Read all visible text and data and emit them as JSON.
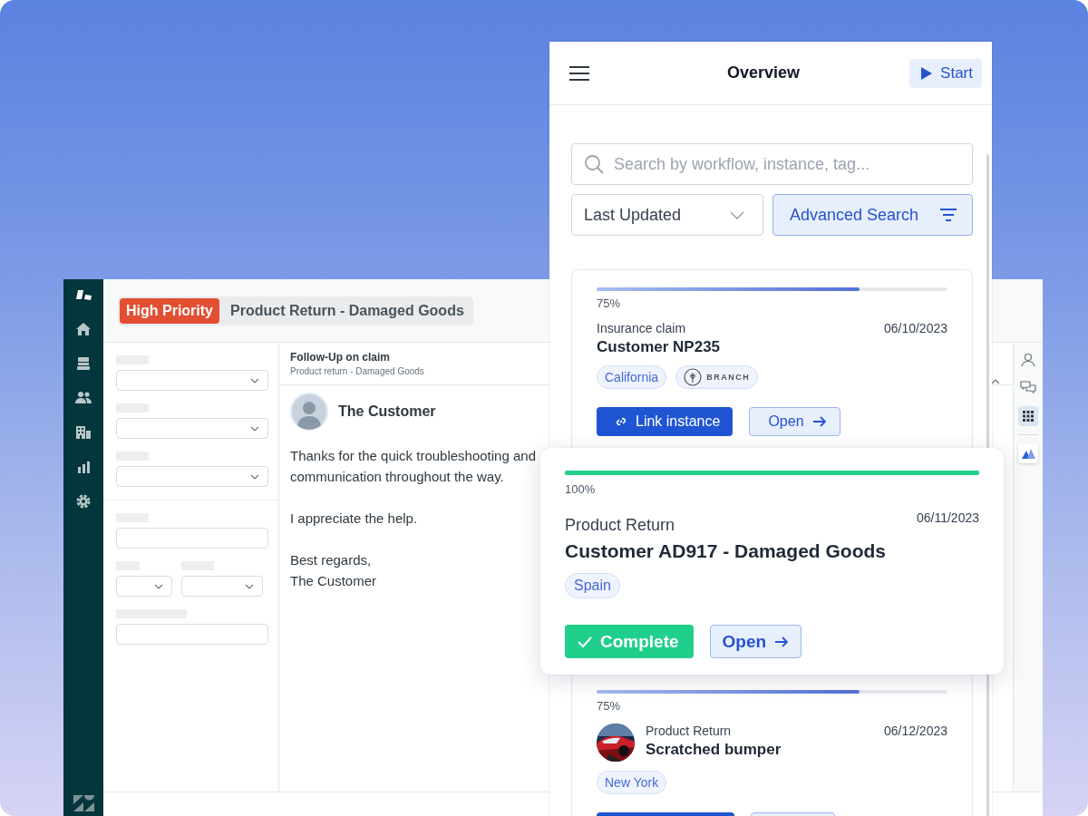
{
  "helpdesk": {
    "ticket_header": {
      "priority": "High Priority",
      "subject": "Product Return - Damaged Goods"
    },
    "form_fields": [
      {
        "kind": "select"
      },
      {
        "kind": "select"
      },
      {
        "kind": "select"
      },
      {
        "kind": "divider"
      },
      {
        "kind": "input"
      },
      {
        "kind": "pair"
      },
      {
        "kind": "input",
        "wide_label": true
      }
    ],
    "conversation": {
      "title": "Follow-Up on claim",
      "subtitle": "Product return - Damaged Goods",
      "author": "The Customer",
      "paragraphs": [
        "Thanks for the quick troubleshooting and communication throughout the way.",
        "I appreciate the help.",
        "Best regards,\nThe Customer"
      ]
    },
    "right_rail": [
      {
        "kind": "person",
        "selected": false
      },
      {
        "kind": "chat",
        "selected": false
      },
      {
        "kind": "grid",
        "selected": true
      },
      {
        "kind": "app",
        "selected": false
      }
    ]
  },
  "overview": {
    "title": "Overview",
    "start_button": "Start",
    "search": {
      "placeholder": "Search by workflow, instance, tag..."
    },
    "sort": {
      "value": "Last Updated"
    },
    "advanced_search": "Advanced Search",
    "cards": [
      {
        "level": 0.75,
        "percent": "75%",
        "workflow": "Insurance claim",
        "date": "06/10/2023",
        "name": "Customer NP235",
        "tags": [
          {
            "kind": "text",
            "label": "California"
          },
          {
            "kind": "brand",
            "label": "BRANCH"
          }
        ],
        "buttons": [
          {
            "kind": "link",
            "label": "Link instance"
          },
          {
            "kind": "open",
            "label": "Open"
          }
        ]
      },
      {
        "level": 0.75,
        "percent": "75%",
        "thumbnail": {
          "kind": "picture"
        },
        "workflow": "Product Return",
        "date": "06/12/2023",
        "name": "Scratched bumper",
        "tags": [
          {
            "kind": "text",
            "label": "New York"
          }
        ],
        "buttons": [
          {
            "kind": "link"
          },
          {
            "kind": "open"
          }
        ]
      }
    ]
  },
  "floating_card": {
    "level": 1,
    "percent": "100%",
    "workflow": "Product Return",
    "date": "06/11/2023",
    "name": "Customer AD917 - Damaged Goods",
    "tags": [
      {
        "kind": "text",
        "label": "Spain"
      }
    ],
    "buttons": [
      {
        "kind": "complete",
        "label": "Complete"
      },
      {
        "kind": "open",
        "label": "Open"
      }
    ]
  }
}
